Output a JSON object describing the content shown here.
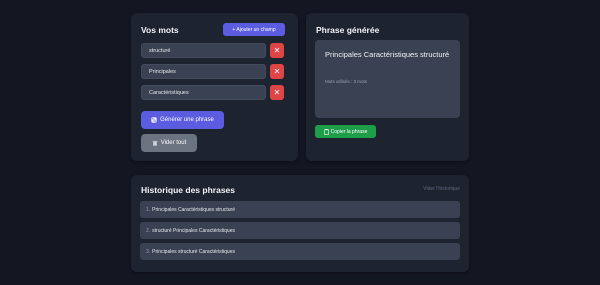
{
  "words_panel": {
    "title": "Vos mots",
    "add_button": "+ Ajouter un champ",
    "words": [
      "structuré",
      "Principales",
      "Caractéristiques"
    ],
    "delete_symbol": "✕",
    "generate_button": "Générer une phrase",
    "clear_button": "Vider tout",
    "generate_icon": "dice-icon",
    "clear_icon": "trash-icon"
  },
  "phrase_panel": {
    "title": "Phrase générée",
    "phrase": "Principales Caractéristiques structuré",
    "meta": "Mots utilisés : 3 mots",
    "copy_button": "Copier la phrase",
    "copy_icon": "clipboard-icon"
  },
  "history_panel": {
    "title": "Historique des phrases",
    "clear_link": "Vider l'historique",
    "items": [
      {
        "num": "1.",
        "text": "Principales Caractéristiques structuré"
      },
      {
        "num": "2.",
        "text": "structuré Principales Caractéristiques"
      },
      {
        "num": "3.",
        "text": "Principales structuré Caractéristiques"
      }
    ]
  },
  "colors": {
    "background": "#131722",
    "card": "#1e2330",
    "primary": "#5b5ce0",
    "danger": "#e04545",
    "success": "#1f9e4a",
    "neutral": "#6b7280"
  }
}
